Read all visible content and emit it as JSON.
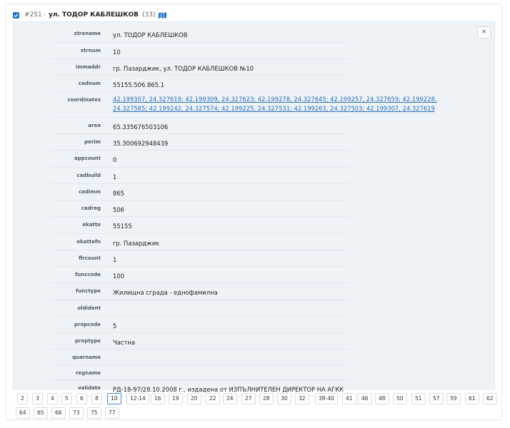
{
  "header": {
    "record_id": "#251",
    "separator": "-",
    "title": "ул. ТОДОР КАБЛЕШКОВ",
    "count": "(33)",
    "checkbox_checked": true,
    "map_icon": "map-icon"
  },
  "close_label": "×",
  "properties": [
    {
      "key": "strename",
      "value": "ул. ТОДОР КАБЛЕШКОВ"
    },
    {
      "key": "strnum",
      "value": "10"
    },
    {
      "key": "immaddr",
      "value": "гр. Пазарджик, ул. ТОДОР КАБЛЕШКОВ №10"
    },
    {
      "key": "cadnum",
      "value": "55155.506.865.1"
    },
    {
      "key": "coordinates",
      "value": "42.199307, 24.327619; 42.199309, 24.327623; 42.199278, 24.327645; 42.199257, 24.327659; 42.199228, 24.327585; 42.199242, 24.327574; 42.199225, 24.327531; 42.199263, 24.327503; 42.199307, 24.327619",
      "link": true
    },
    {
      "key": "area",
      "value": "65.335676503106"
    },
    {
      "key": "perim",
      "value": "35.300692948439"
    },
    {
      "key": "appcount",
      "value": "0"
    },
    {
      "key": "cadbuild",
      "value": "1"
    },
    {
      "key": "cadimm",
      "value": "865"
    },
    {
      "key": "cadreg",
      "value": "506"
    },
    {
      "key": "ekatte",
      "value": "55155"
    },
    {
      "key": "ekattefn",
      "value": "гр. Пазарджик"
    },
    {
      "key": "flrcount",
      "value": "1"
    },
    {
      "key": "funccode",
      "value": "100"
    },
    {
      "key": "functype",
      "value": "Жилищна сграда - еднофамилна"
    },
    {
      "key": "oldident",
      "value": ""
    },
    {
      "key": "propcode",
      "value": "5"
    },
    {
      "key": "proptype",
      "value": "Частна"
    },
    {
      "key": "quarname",
      "value": ""
    },
    {
      "key": "regname",
      "value": ""
    },
    {
      "key": "validate",
      "value": "РД-18-97/28.10.2008 г., издадена от ИЗПЪЛНИТЕЛЕН ДИРЕКТОР НА АГКК"
    }
  ],
  "pagination": {
    "active": "10",
    "pages": [
      "2",
      "3",
      "4",
      "5",
      "6",
      "8",
      "10",
      "12-14",
      "16",
      "19",
      "20",
      "22",
      "24",
      "27",
      "28",
      "30",
      "32",
      "38-40",
      "41",
      "46",
      "48",
      "50",
      "51",
      "57",
      "59",
      "61",
      "62",
      "64",
      "65",
      "66",
      "73",
      "75",
      "77"
    ]
  }
}
